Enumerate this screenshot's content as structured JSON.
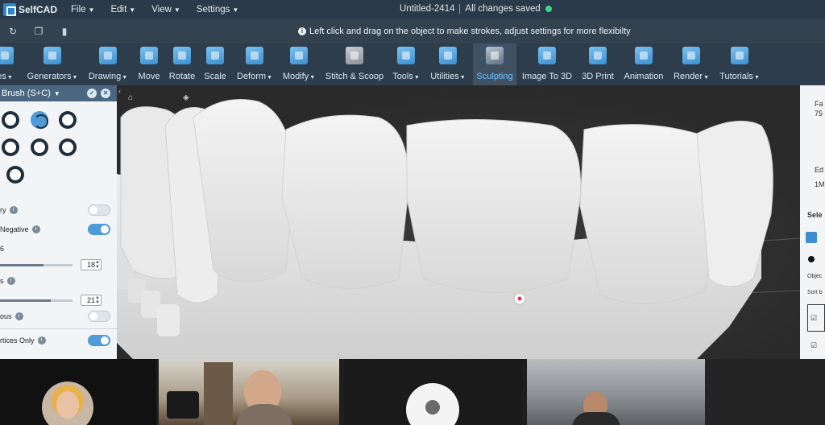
{
  "app": {
    "brand": "SelfCAD",
    "menus": [
      "File",
      "Edit",
      "View",
      "Settings"
    ],
    "document_title": "Untitled-2414",
    "save_status": "All changes saved"
  },
  "hint": "Left click and drag on the object to make strokes, adjust settings for more flexibilty",
  "toolbar": {
    "items": [
      {
        "label": "es",
        "dropdown": true
      },
      {
        "label": "Generators",
        "dropdown": true
      },
      {
        "label": "Drawing",
        "dropdown": true
      },
      {
        "label": "Move",
        "dropdown": false
      },
      {
        "label": "Rotate",
        "dropdown": false
      },
      {
        "label": "Scale",
        "dropdown": false
      },
      {
        "label": "Deform",
        "dropdown": true
      },
      {
        "label": "Modify",
        "dropdown": true
      },
      {
        "label": "Stitch & Scoop",
        "dropdown": false
      },
      {
        "label": "Tools",
        "dropdown": true
      },
      {
        "label": "Utilities",
        "dropdown": true
      },
      {
        "label": "Sculpting",
        "dropdown": false
      },
      {
        "label": "Image To 3D",
        "dropdown": false
      },
      {
        "label": "3D Print",
        "dropdown": false
      },
      {
        "label": "Animation",
        "dropdown": false
      },
      {
        "label": "Render",
        "dropdown": true
      },
      {
        "label": "Tutorials",
        "dropdown": true
      }
    ],
    "active": "Sculpting"
  },
  "brush_panel": {
    "title": "Brush (S+C)",
    "options": [
      {
        "label": "ry",
        "control": "toggle",
        "on": false
      },
      {
        "label": "Negative",
        "control": "toggle",
        "on": true
      },
      {
        "label": "6",
        "control": "slider",
        "value": "18",
        "fraction": 0.6
      },
      {
        "label": "s",
        "control": "slider",
        "value": "21",
        "fraction": 0.7
      },
      {
        "label": "ous",
        "control": "toggle",
        "on": false
      },
      {
        "label": "rtices Only",
        "control": "toggle",
        "on": true
      }
    ]
  },
  "right_panel": {
    "texts": [
      "Fa",
      "75",
      "Ed",
      "1M",
      "Sele",
      "Objec",
      "Sort b"
    ]
  },
  "colors": {
    "accent": "#4e9bd8",
    "saved": "#3dd68c",
    "menubar": "#2b3a4a",
    "toolbar": "#2e3d4c"
  }
}
